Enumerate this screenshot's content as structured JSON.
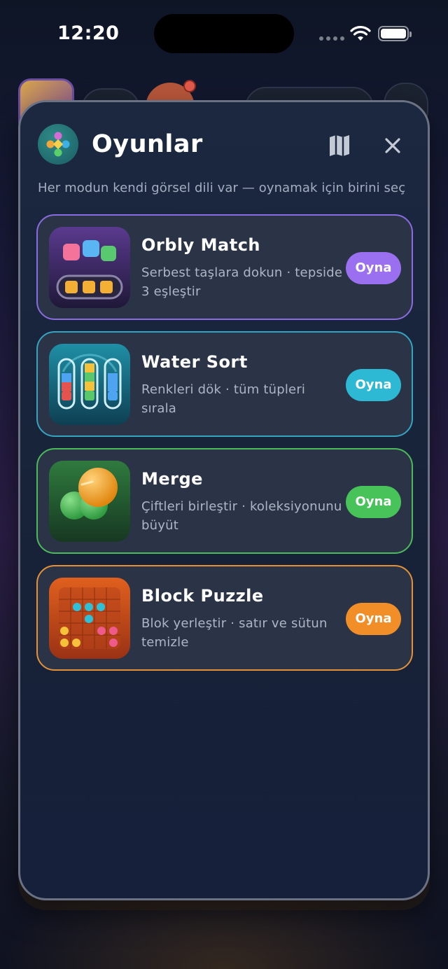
{
  "status_bar": {
    "time": "12:20"
  },
  "modal": {
    "title": "Oyunlar",
    "subtitle": "Her modun kendi görsel dili var — oynamak için birini seç",
    "map_icon": "map-icon",
    "close_icon": "close-icon"
  },
  "games": [
    {
      "name": "Orbly Match",
      "description": "Serbest taşlara dokun · tepside 3 eşleştir",
      "play_label": "Oyna",
      "accent": "#9a6ff0"
    },
    {
      "name": "Water Sort",
      "description": "Renkleri dök · tüm tüpleri sırala",
      "play_label": "Oyna",
      "accent": "#2db9d4"
    },
    {
      "name": "Merge",
      "description": "Çiftleri birleştir · koleksiyonunu büyüt",
      "play_label": "Oyna",
      "accent": "#47c35a"
    },
    {
      "name": "Block Puzzle",
      "description": "Blok yerleştir · satır ve sütun temizle",
      "play_label": "Oyna",
      "accent": "#f28e28"
    }
  ]
}
